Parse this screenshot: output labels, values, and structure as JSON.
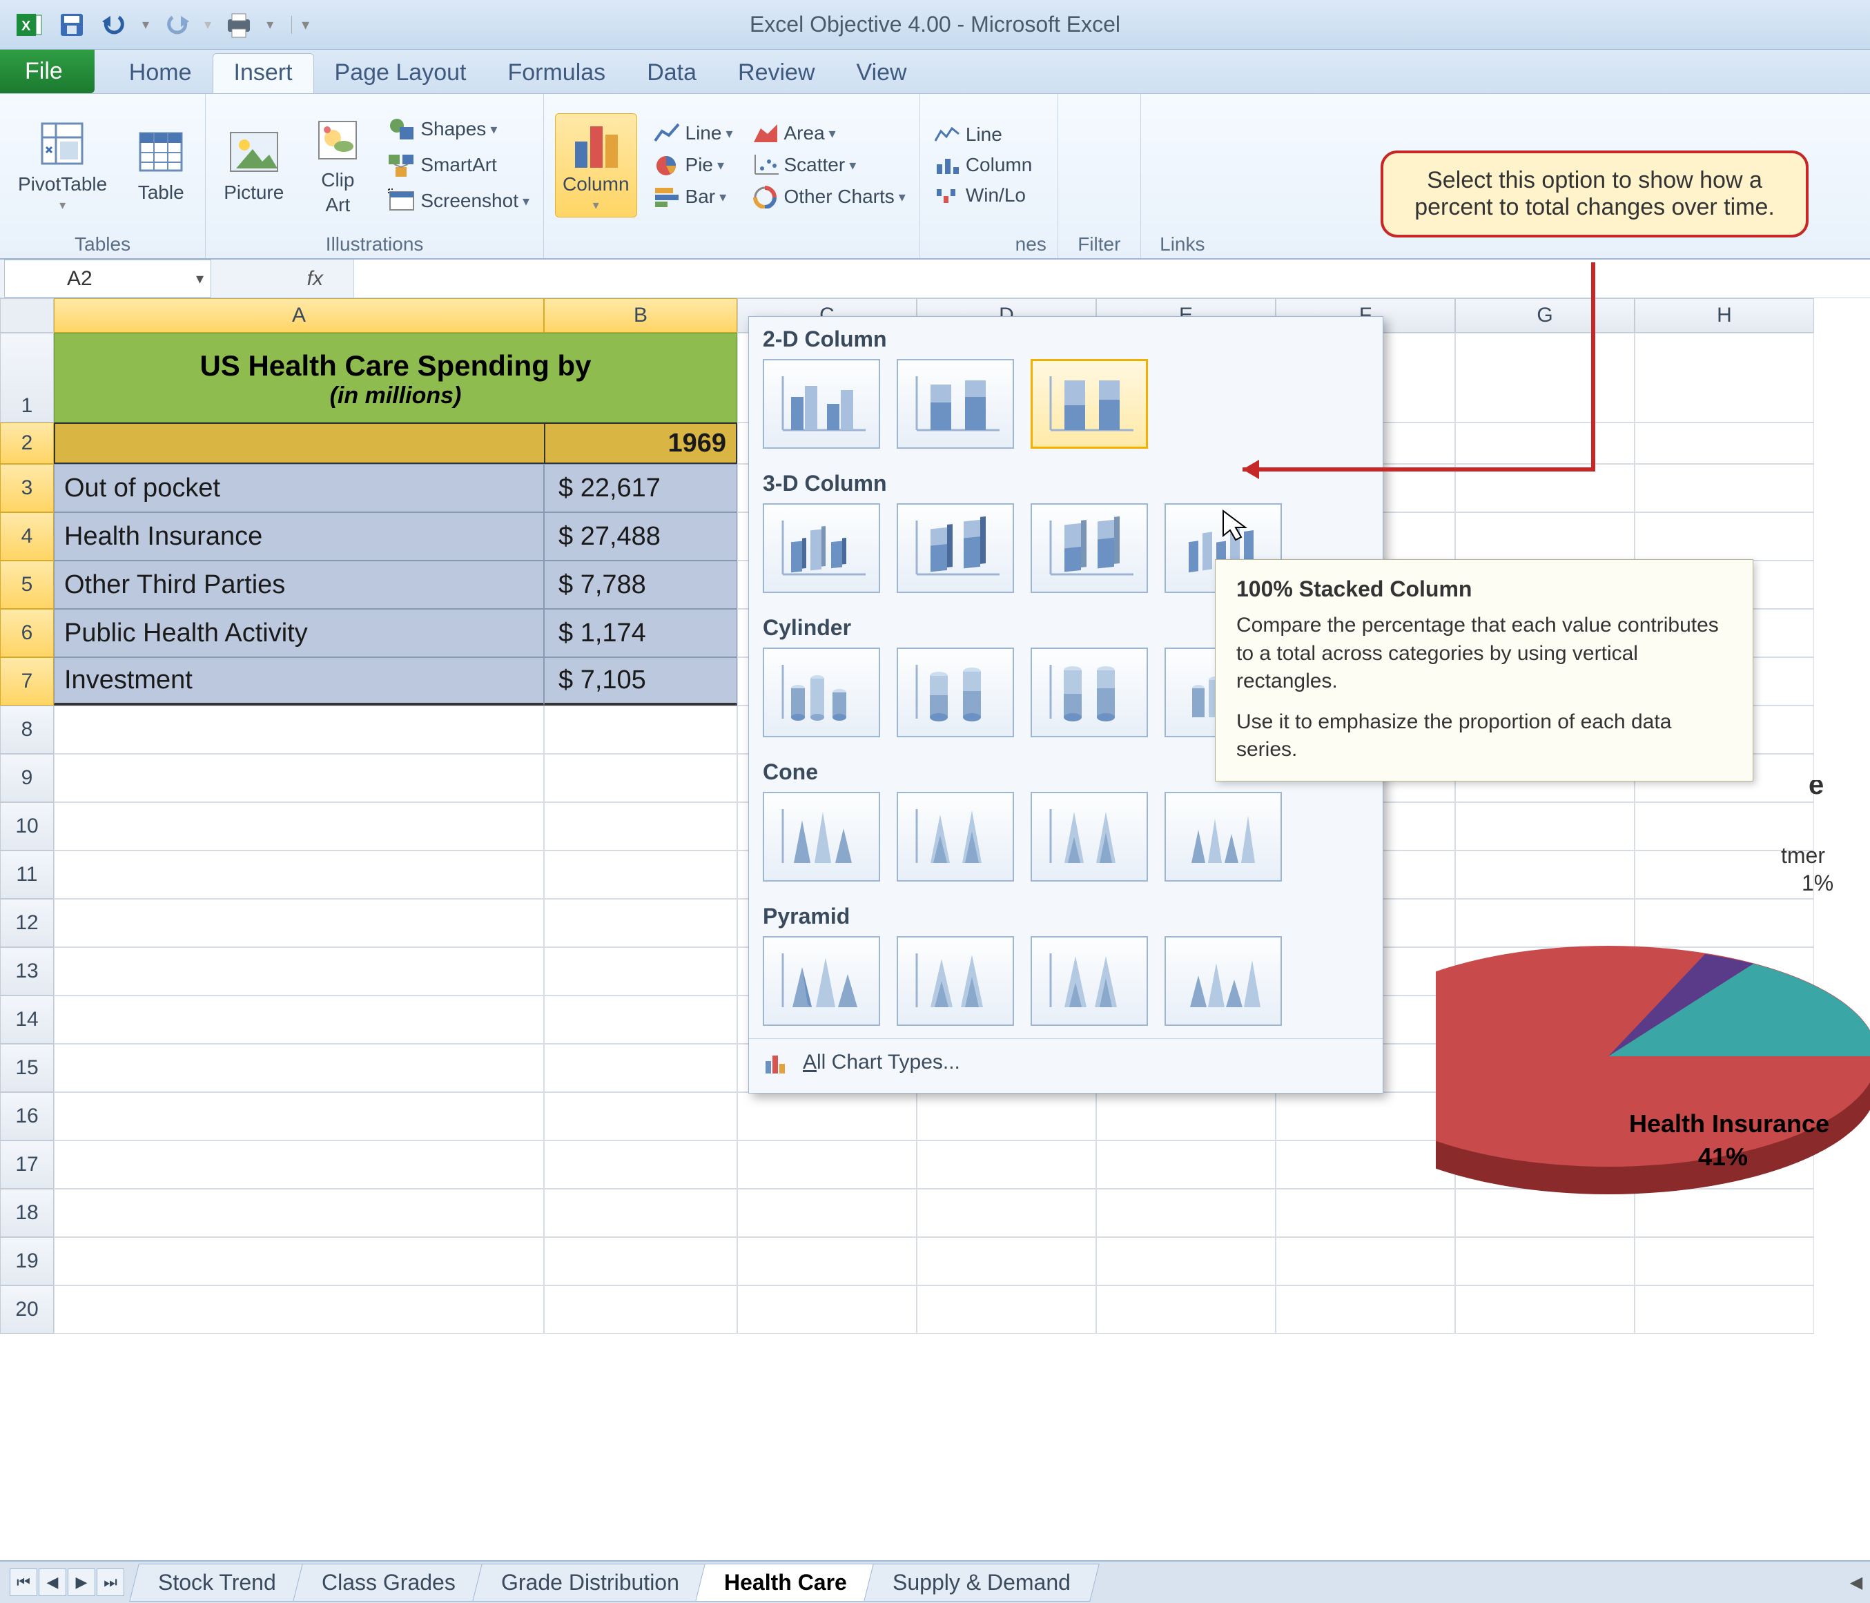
{
  "window_title": "Excel Objective 4.00  -  Microsoft Excel",
  "tabs": {
    "file": "File",
    "list": [
      "Home",
      "Insert",
      "Page Layout",
      "Formulas",
      "Data",
      "Review",
      "View"
    ],
    "active": "Insert"
  },
  "ribbon": {
    "tables": {
      "label": "Tables",
      "pivottable": "PivotTable",
      "table": "Table"
    },
    "illustrations": {
      "label": "Illustrations",
      "picture": "Picture",
      "clipart_l1": "Clip",
      "clipart_l2": "Art",
      "shapes": "Shapes",
      "smartart": "SmartArt",
      "screenshot": "Screenshot"
    },
    "charts": {
      "column": "Column",
      "line": "Line",
      "pie": "Pie",
      "bar": "Bar",
      "area": "Area",
      "scatter": "Scatter",
      "other": "Other Charts"
    },
    "sparklines": {
      "line": "Line",
      "column": "Column",
      "winloss": "Win/Loss",
      "label_suffix": "nes"
    },
    "filter": "Filter",
    "links": "Links"
  },
  "namebox": "A2",
  "fx": "fx",
  "columns": [
    "A",
    "B",
    "C",
    "D",
    "E",
    "F",
    "G",
    "H"
  ],
  "sheet": {
    "title": "US Health Care Spending by",
    "subtitle": "(in millions)",
    "year": "1969",
    "rows": [
      {
        "label": "Out of pocket",
        "value": "$  22,617"
      },
      {
        "label": "Health Insurance",
        "value": "$  27,488"
      },
      {
        "label": "Other Third Parties",
        "value": "$    7,788"
      },
      {
        "label": "Public Health Activity",
        "value": "$    1,174"
      },
      {
        "label": "Investment",
        "value": "$    7,105"
      }
    ]
  },
  "dropdown": {
    "sections": [
      "2-D Column",
      "3-D Column",
      "Cylinder",
      "Cone",
      "Pyramid"
    ],
    "all_chart_types": "All Chart Types..."
  },
  "tooltip": {
    "title": "100% Stacked Column",
    "p1": "Compare the percentage that each value contributes to a total across categories by using vertical rectangles.",
    "p2": "Use it to emphasize the proportion of each data series."
  },
  "callout": "Select this option to show how a percent to total changes over time.",
  "pie_labels": {
    "main": "Health Insurance",
    "pct": "41%",
    "tmer": "tmer",
    "one": "1%"
  },
  "sheet_tabs": [
    "Stock Trend",
    "Class Grades",
    "Grade Distribution",
    "Health Care",
    "Supply & Demand"
  ],
  "active_sheet": "Health Care",
  "chart_data": {
    "type": "table",
    "title": "US Health Care Spending (in millions), 1969",
    "categories": [
      "Out of pocket",
      "Health Insurance",
      "Other Third Parties",
      "Public Health Activity",
      "Investment"
    ],
    "values": [
      22617,
      27488,
      7788,
      1174,
      7105
    ]
  }
}
